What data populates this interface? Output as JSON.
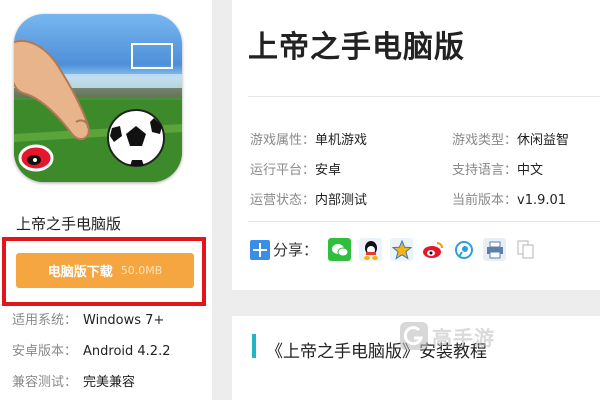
{
  "app": {
    "name": "上帝之手电脑版"
  },
  "download": {
    "label": "电脑版下载",
    "size": "50.0MB"
  },
  "left_info": [
    {
      "key": "适用系统：",
      "value": "Windows 7+"
    },
    {
      "key": "安卓版本：",
      "value": "Android 4.2.2"
    },
    {
      "key": "兼容测试：",
      "value": "完美兼容"
    }
  ],
  "title": "上帝之手电脑版",
  "attributes": [
    {
      "key": "游戏属性：",
      "value": "单机游戏"
    },
    {
      "key": "游戏类型：",
      "value": "休闲益智"
    },
    {
      "key": "运行平台：",
      "value": "安卓"
    },
    {
      "key": "支持语言：",
      "value": "中文"
    },
    {
      "key": "运营状态：",
      "value": "内部测试"
    },
    {
      "key": "当前版本：",
      "value": "v1.9.01"
    }
  ],
  "share": {
    "label": "分享："
  },
  "share_icons": [
    "wechat-icon",
    "qq-icon",
    "qzone-icon",
    "weibo-icon",
    "tencent-weibo-icon",
    "print-icon",
    "copy-icon"
  ],
  "section": {
    "title": "《上帝之手电脑版》安装教程"
  },
  "watermark": {
    "text": "高手游"
  },
  "colors": {
    "download_button": "#f5a640",
    "highlight_border": "#e0161c",
    "accent": "#1fb6c5"
  }
}
